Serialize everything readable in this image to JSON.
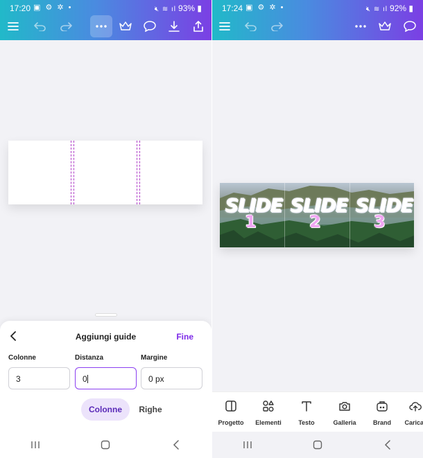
{
  "left": {
    "status": {
      "time": "17:20",
      "battery": "93%"
    },
    "toolbar": {
      "icons": [
        "menu-icon",
        "undo-icon",
        "redo-icon",
        "more-icon",
        "crown-icon",
        "comment-icon",
        "download-icon",
        "share-icon"
      ]
    },
    "sheet": {
      "title": "Aggiungi guide",
      "done_label": "Fine",
      "fields": [
        {
          "label": "Colonne",
          "value": "3"
        },
        {
          "label": "Distanza",
          "value": "0"
        },
        {
          "label": "Margine",
          "value": "0 px"
        }
      ],
      "tabs": [
        {
          "label": "Colonne",
          "active": true
        },
        {
          "label": "Righe",
          "active": false
        }
      ]
    }
  },
  "right": {
    "status": {
      "time": "17:24",
      "battery": "92%"
    },
    "toolbar": {
      "icons": [
        "menu-icon",
        "undo-icon",
        "redo-icon",
        "more-icon",
        "crown-icon",
        "comment-icon"
      ]
    },
    "slides": [
      {
        "word": "SLIDE",
        "number": "1"
      },
      {
        "word": "SLIDE",
        "number": "2"
      },
      {
        "word": "SLIDE",
        "number": "3"
      }
    ],
    "tools": [
      {
        "label": "Progetto",
        "icon": "layout-icon"
      },
      {
        "label": "Elementi",
        "icon": "shapes-icon"
      },
      {
        "label": "Testo",
        "icon": "text-icon"
      },
      {
        "label": "Galleria",
        "icon": "camera-icon"
      },
      {
        "label": "Brand",
        "icon": "brand-icon"
      },
      {
        "label": "Caricar",
        "icon": "upload-cloud-icon"
      }
    ]
  },
  "colors": {
    "accent": "#7d2ae8",
    "gradient_start": "#21b9c9",
    "gradient_end": "#7b3fe4",
    "guide": "#b040c8",
    "slide_number": "#f0a6f3"
  }
}
